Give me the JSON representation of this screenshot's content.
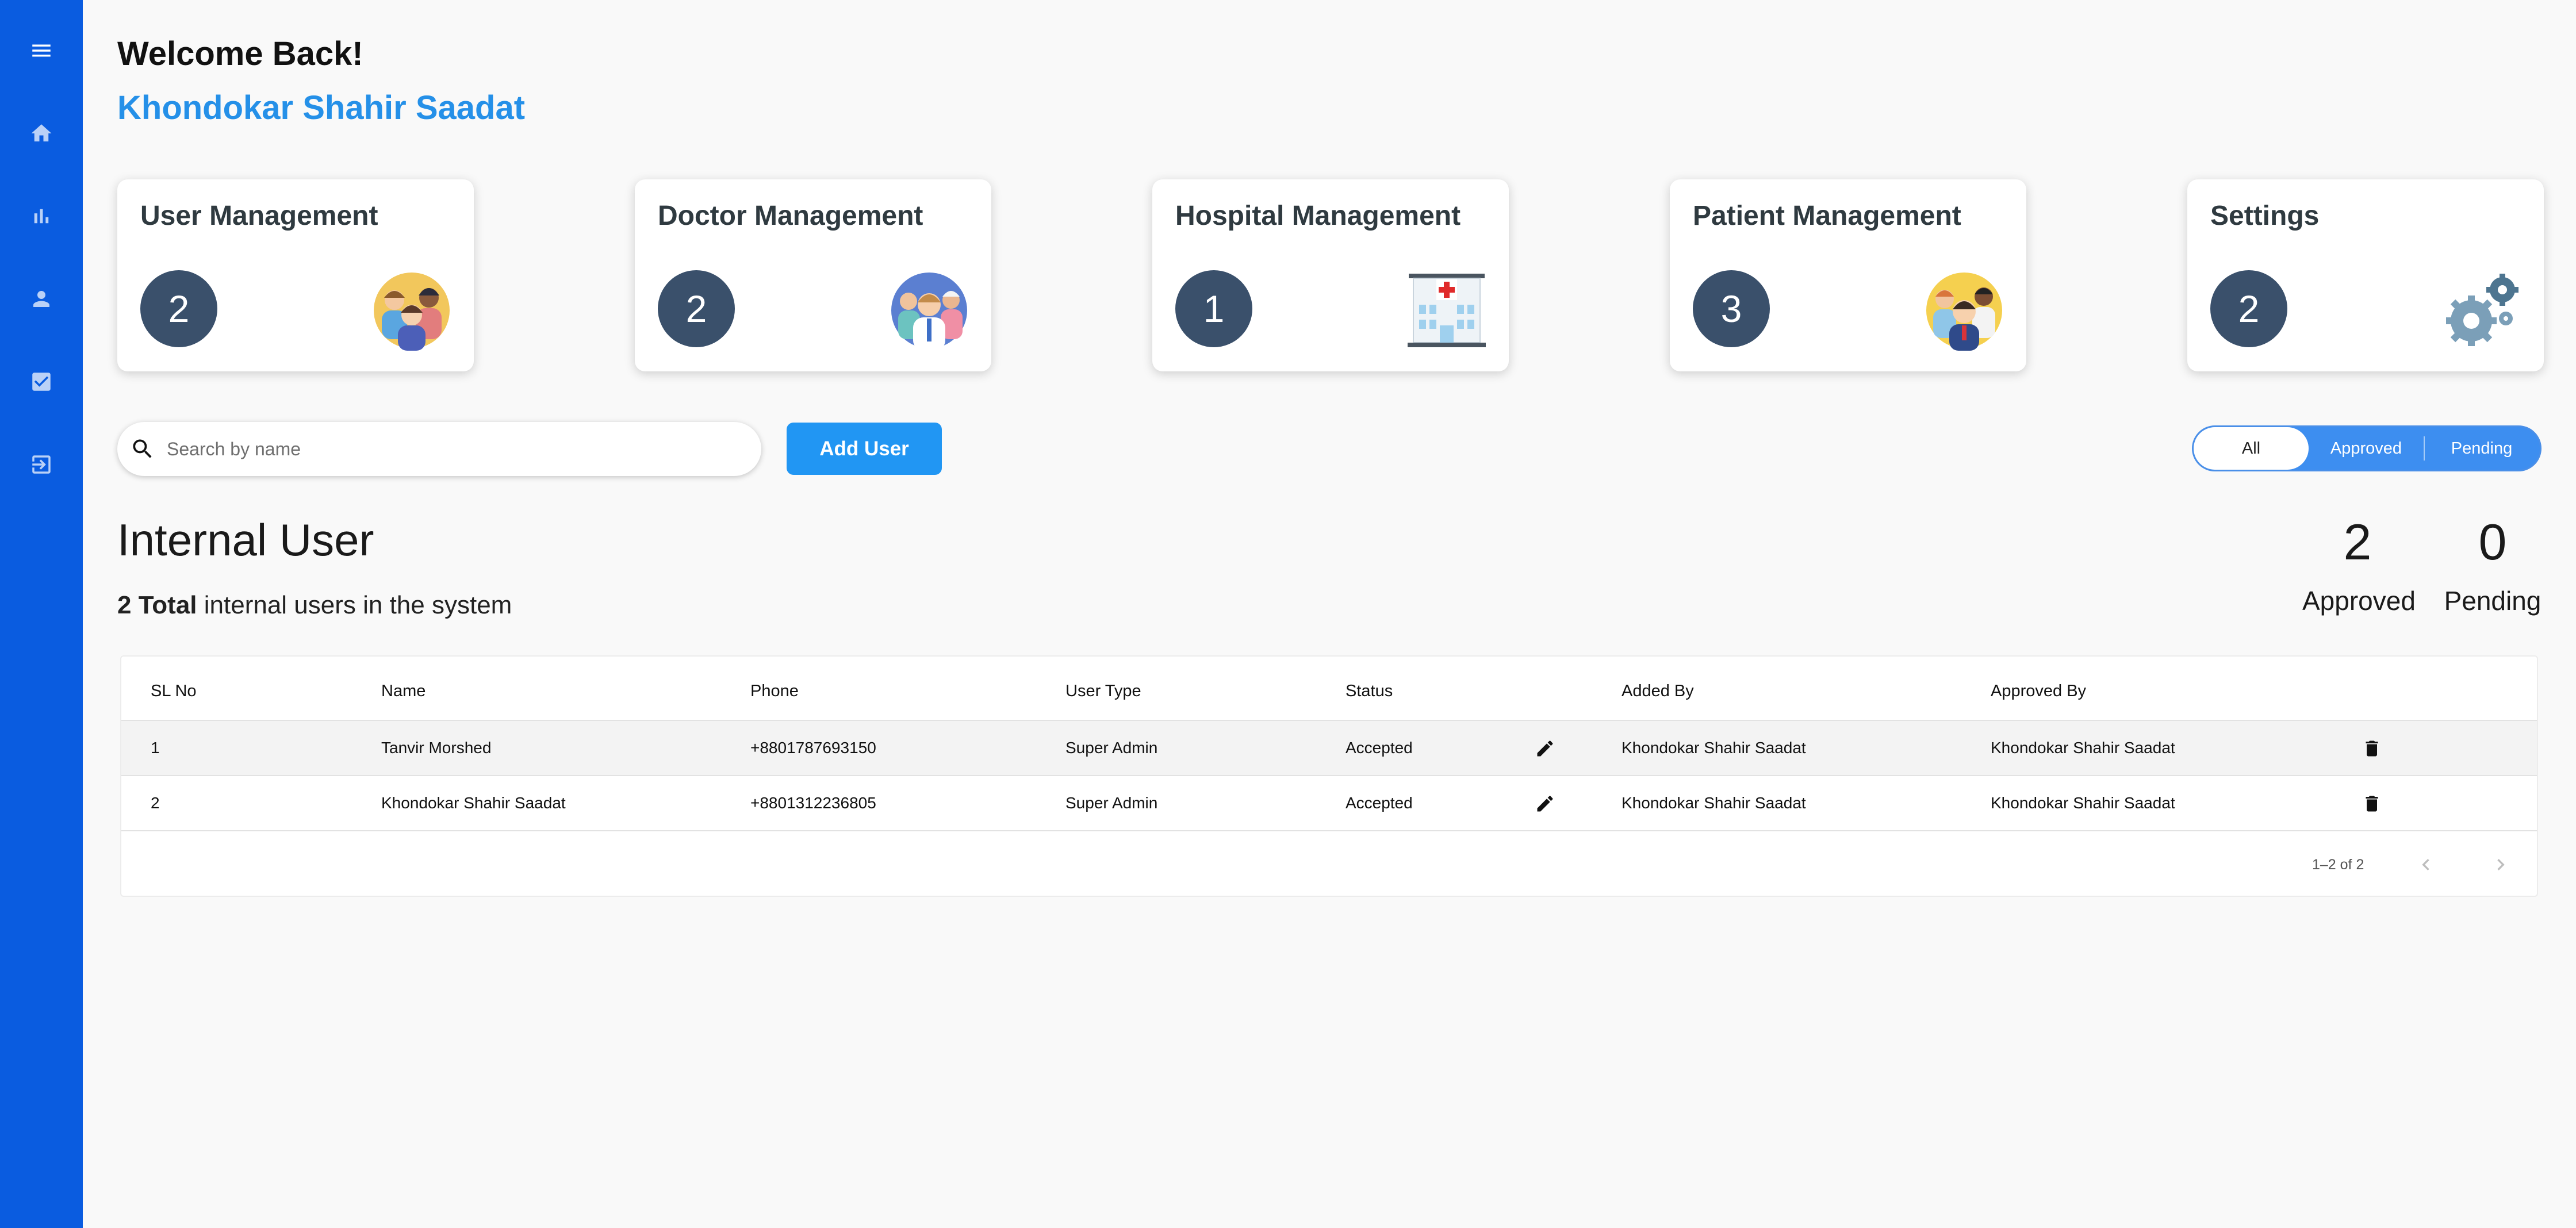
{
  "sidebar": {
    "items": [
      {
        "icon": "menu-icon"
      },
      {
        "icon": "home-icon"
      },
      {
        "icon": "bar-chart-icon"
      },
      {
        "icon": "person-icon"
      },
      {
        "icon": "check-box-icon"
      },
      {
        "icon": "logout-icon"
      }
    ],
    "color": "#0a5ce0"
  },
  "header": {
    "welcome": "Welcome Back!",
    "user_name": "Khondokar Shahir Saadat"
  },
  "cards": [
    {
      "title": "User Management",
      "count": "2",
      "illustration": "users-group-illustration"
    },
    {
      "title": "Doctor Management",
      "count": "2",
      "illustration": "doctors-illustration"
    },
    {
      "title": "Hospital Management",
      "count": "1",
      "illustration": "hospital-building-illustration"
    },
    {
      "title": "Patient Management",
      "count": "3",
      "illustration": "patients-illustration"
    },
    {
      "title": "Settings",
      "count": "2",
      "illustration": "gears-illustration"
    }
  ],
  "search": {
    "placeholder": "Search by name",
    "value": ""
  },
  "add_user_label": "Add User",
  "filter": {
    "options": [
      "All",
      "Approved",
      "Pending"
    ],
    "selected": "All"
  },
  "section": {
    "title": "Internal User",
    "total_count": "2 Total",
    "total_text": " internal users in the system",
    "approved_count": "2",
    "approved_label": "Approved",
    "pending_count": "0",
    "pending_label": "Pending"
  },
  "table": {
    "columns": [
      "SL No",
      "Name",
      "Phone",
      "User Type",
      "Status",
      "Added By",
      "Approved By"
    ],
    "rows": [
      {
        "sl": "1",
        "name": "Tanvir Morshed",
        "phone": "+8801787693150",
        "type": "Super Admin",
        "status": "Accepted",
        "added_by": "Khondokar Shahir Saadat",
        "approved_by": "Khondokar Shahir Saadat"
      },
      {
        "sl": "2",
        "name": "Khondokar Shahir Saadat",
        "phone": "+8801312236805",
        "type": "Super Admin",
        "status": "Accepted",
        "added_by": "Khondokar Shahir Saadat",
        "approved_by": "Khondokar Shahir Saadat"
      }
    ],
    "pagination": "1–2 of 2"
  },
  "colors": {
    "accent": "#2196f3",
    "count_circle": "#3a506b",
    "title_blue": "#2590e8"
  }
}
